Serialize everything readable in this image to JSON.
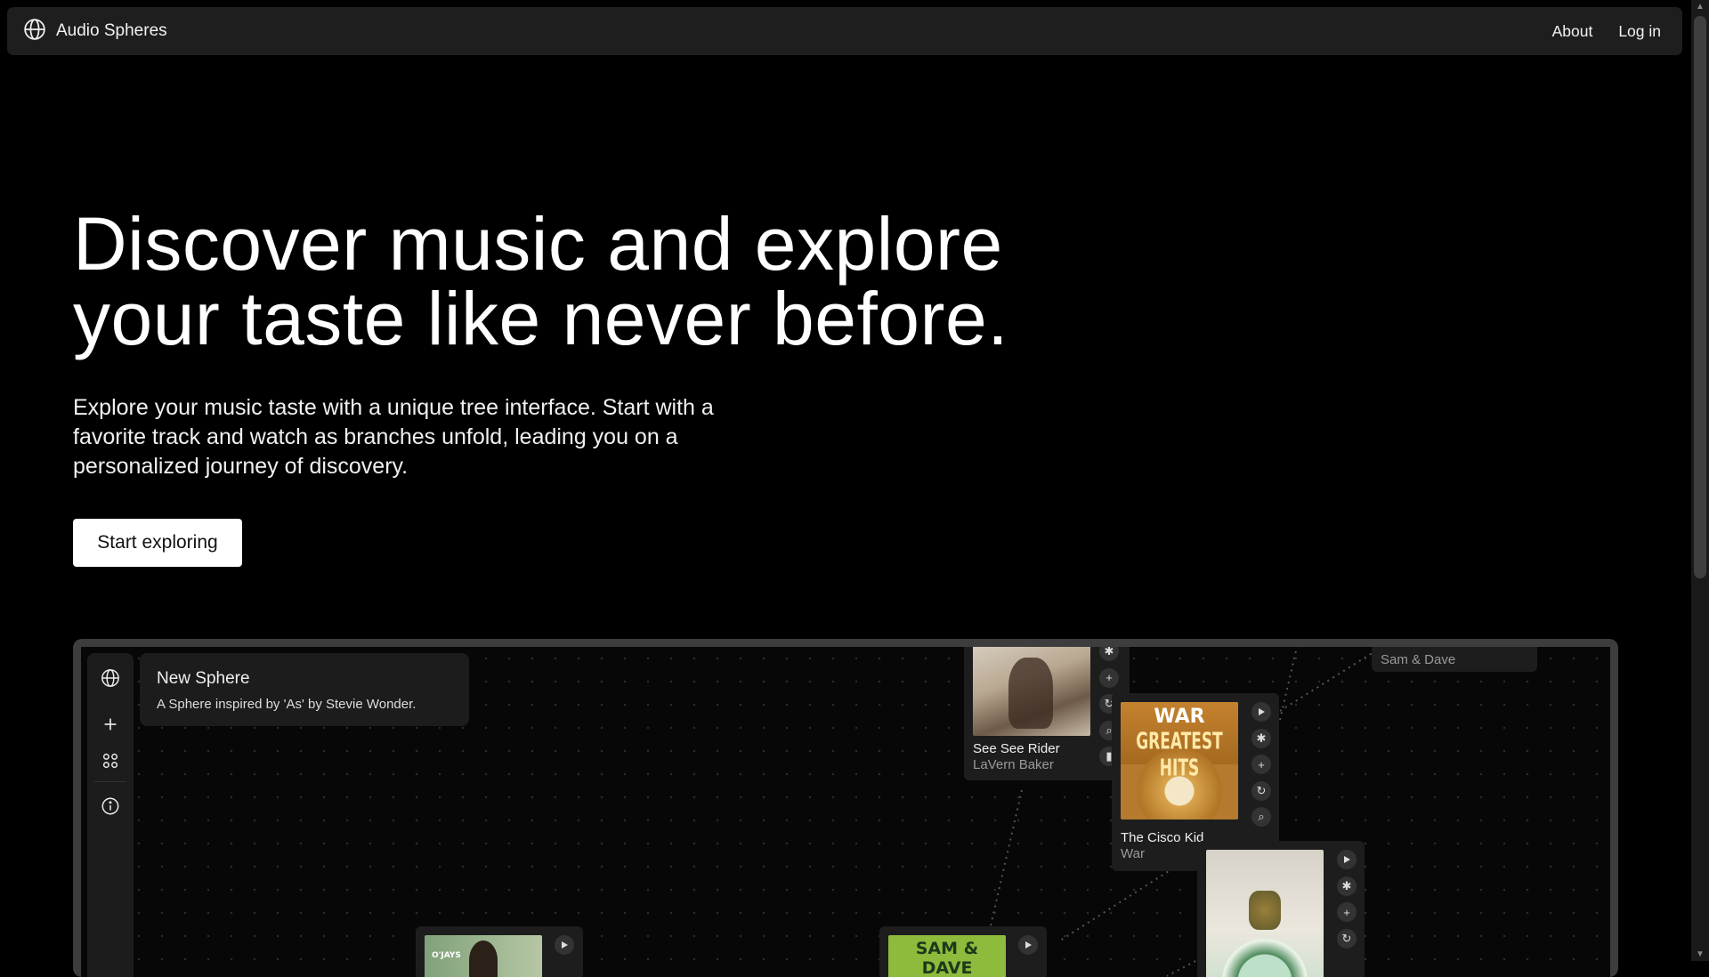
{
  "header": {
    "app_name": "Audio Spheres",
    "nav": {
      "about": "About",
      "login": "Log in"
    }
  },
  "hero": {
    "title_line1": "Discover music and explore",
    "title_line2": "your taste like never before.",
    "subtitle_line1": "Explore your music taste with a unique tree interface. Start with a",
    "subtitle_line2": "favorite track and watch as branches unfold, leading you on a",
    "subtitle_line3": "personalized journey of discovery.",
    "cta_label": "Start exploring"
  },
  "app_preview": {
    "toolbar": {
      "icons": [
        "globe-icon",
        "plus-icon",
        "grid-icon",
        "info-icon"
      ]
    },
    "sphere_panel": {
      "title": "New Sphere",
      "description": "A Sphere inspired by 'As' by Stevie Wonder."
    },
    "nodes": [
      {
        "title": "See See Rider",
        "artist": "LaVern Baker"
      },
      {
        "title": "The Cisco Kid",
        "artist": "War",
        "cover_text_top": "WAR",
        "cover_text_main": "GREATEST HITS"
      },
      {
        "title": "",
        "artist": "Sam & Dave"
      },
      {
        "cover_text": "SAM & DAVE"
      },
      {
        "cover_text": "O'JAYS"
      }
    ]
  },
  "colors": {
    "background": "#000000",
    "navbar": "#1e1e1e",
    "panel": "#1c1c1c",
    "button_bg": "#ffffff"
  }
}
